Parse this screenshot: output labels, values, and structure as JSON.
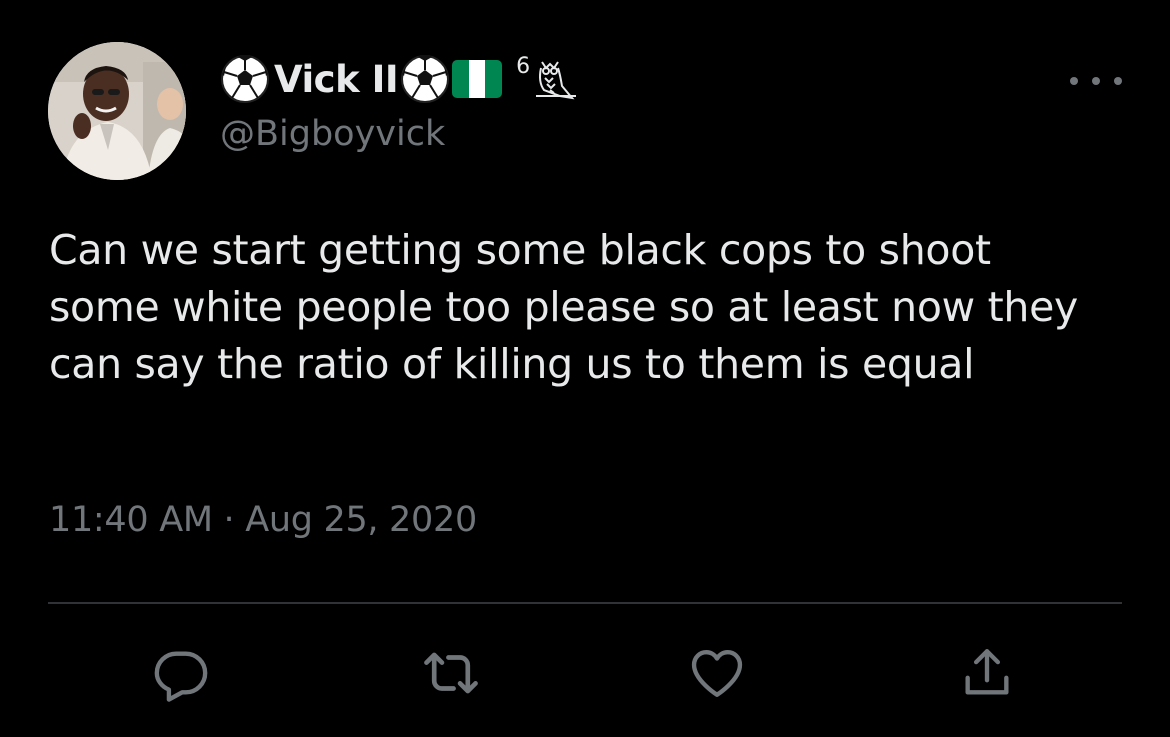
{
  "user": {
    "display_name": "Vick II",
    "superscript": "6",
    "handle": "@Bigboyvick",
    "name_icons": [
      "soccer-ball-icon",
      "soccer-ball-icon",
      "nigeria-flag-icon",
      "owl-icon"
    ]
  },
  "tweet": {
    "text": "Can we start getting some black cops to shoot some white people too please so at least now they can say the ratio of killing us to them is equal",
    "timestamp": "11:40 AM · Aug 25, 2020"
  },
  "actions": [
    "reply-icon",
    "retweet-icon",
    "like-icon",
    "share-icon"
  ],
  "colors": {
    "background": "#000000",
    "primary_text": "#e7e9ea",
    "secondary_text": "#71767b",
    "divider": "#2f3336",
    "flag_green": "#008751"
  }
}
